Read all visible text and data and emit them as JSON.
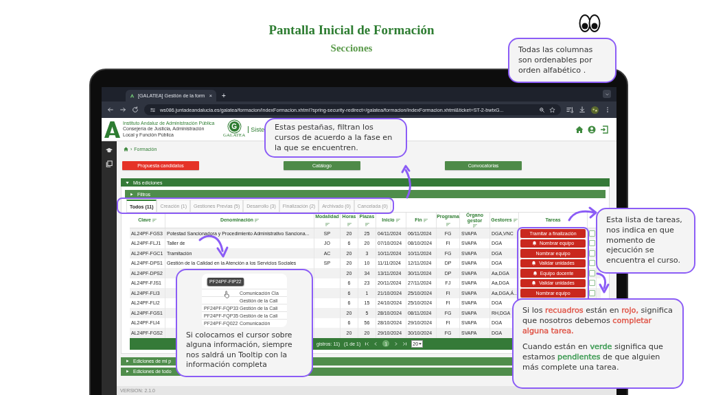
{
  "slide": {
    "title": "Pantalla Inicial de Formación",
    "subtitle": "Secciones"
  },
  "browser": {
    "tab_title": "[GALATEA] Gestión de la form",
    "tab_close": "×",
    "new_tab": "+",
    "url": "ws086.juntadeandalucia.es/galatea/formacion/indexFormacion.xhtml?spring-security-redirect=/galatea/formacion/indexFormacion.xhtml&ticket=ST-2-bwtxG..."
  },
  "header": {
    "org_lines": [
      "Instituto Andaluz de Administración Pública",
      "Consejería de Justicia, Administración",
      "Local y Función Pública"
    ],
    "logo_letter": "G",
    "logo_caption": "GALATEA",
    "system_name": "Siste"
  },
  "breadcrumb": {
    "separator": "›",
    "label": "Formación"
  },
  "actions": [
    {
      "label": "Propuesta candidatos",
      "kind": "alert"
    },
    {
      "label": "Catálogo",
      "kind": "normal"
    },
    {
      "label": "Convocatorias",
      "kind": "normal"
    }
  ],
  "panel": {
    "title": "Mis ediciones",
    "expanded": true
  },
  "filters": {
    "title": "Filtros",
    "expanded": false
  },
  "tabs": [
    {
      "label": "Todos (11)",
      "selected": true
    },
    {
      "label": "Creación (1)",
      "selected": false
    },
    {
      "label": "Gestiones Previas (5)",
      "selected": false
    },
    {
      "label": "Desarrollo (3)",
      "selected": false
    },
    {
      "label": "Finalización (2)",
      "selected": false
    },
    {
      "label": "Archivado (0)",
      "selected": false
    },
    {
      "label": "Cancelada (0)",
      "selected": false
    }
  ],
  "table": {
    "columns": [
      {
        "label": "Clave",
        "sortable": true
      },
      {
        "label": "Denominación",
        "sortable": true
      },
      {
        "label": "Modalidad",
        "sortable": true
      },
      {
        "label": "Horas",
        "sortable": true
      },
      {
        "label": "Plazas",
        "sortable": true
      },
      {
        "label": "Inicio",
        "sortable": true
      },
      {
        "label": "Fin",
        "sortable": true
      },
      {
        "label": "Programa",
        "sortable": true
      },
      {
        "label": "Órgano gestor",
        "sortable": true
      },
      {
        "label": "Gestores",
        "sortable": true
      },
      {
        "label": "Tareas",
        "sortable": false
      }
    ],
    "rows": [
      {
        "clave": "AL24PF-FGS3",
        "denominacion": "Potestad Sancionadora y Procedimiento Administrativo Sanciona...",
        "modalidad": "SP",
        "horas": "20",
        "plazas": "25",
        "inicio": "04/11/2024",
        "fin": "06/11/2024",
        "programa": "FG",
        "organo": "SVAPA",
        "gestores": "DGA,VNC",
        "task": {
          "label": "Tramitar a finalización",
          "bell": false,
          "kind": "required"
        },
        "checked": false
      },
      {
        "clave": "AL24PF-FLJ1",
        "denominacion": "Taller de",
        "modalidad": "JO",
        "horas": "6",
        "plazas": "20",
        "inicio": "07/10/2024",
        "fin": "08/10/2024",
        "programa": "FI",
        "organo": "SVAPA",
        "gestores": "DGA",
        "task": {
          "label": "Nombrar equipo",
          "bell": true,
          "kind": "required"
        },
        "checked": false
      },
      {
        "clave": "AL24PF-FGC1",
        "denominacion": "Tramitación",
        "modalidad": "AC",
        "horas": "20",
        "plazas": "3",
        "inicio": "10/11/2024",
        "fin": "10/11/2024",
        "programa": "FG",
        "organo": "SVAPA",
        "gestores": "DGA",
        "task": {
          "label": "Nombrar equipo",
          "bell": false,
          "kind": "required"
        },
        "checked": false
      },
      {
        "clave": "AL24PF-DPS1",
        "denominacion": "Gestión de la Calidad en la Atención a los Servicios Sociales",
        "modalidad": "SP",
        "horas": "20",
        "plazas": "10",
        "inicio": "11/11/2024",
        "fin": "12/11/2024",
        "programa": "DP",
        "organo": "SVAPA",
        "gestores": "DGA",
        "task": {
          "label": "Validar unidades",
          "bell": true,
          "kind": "required"
        },
        "checked": false
      },
      {
        "clave": "AL24PF-DPS2",
        "horas": "20",
        "plazas": "34",
        "inicio": "13/11/2024",
        "fin": "30/11/2024",
        "programa": "DP",
        "organo": "SVAPA",
        "gestores": "Aa,DGA",
        "task": {
          "label": "Equipo docente",
          "bell": true,
          "kind": "required"
        },
        "checked": false
      },
      {
        "clave": "AL24PF-FJS1",
        "horas": "6",
        "plazas": "23",
        "inicio": "20/11/2024",
        "fin": "27/11/2024",
        "programa": "FJ",
        "organo": "SVAPA",
        "gestores": "Aa,DGA",
        "task": {
          "label": "Validar unidades",
          "bell": true,
          "kind": "required"
        },
        "checked": false
      },
      {
        "clave": "AL24PF-FLI3",
        "horas": "6",
        "plazas": "1",
        "inicio": "21/10/2024",
        "fin": "25/10/2024",
        "programa": "FI",
        "organo": "SVAPA",
        "gestores": "Aa,DGA,Á...",
        "task": {
          "label": "Nombrar equipo",
          "bell": false,
          "kind": "required"
        },
        "checked": false
      },
      {
        "clave": "AL24PF-FLI2",
        "horas": "6",
        "plazas": "15",
        "inicio": "24/10/2024",
        "fin": "25/10/2024",
        "programa": "FI",
        "organo": "SVAPA",
        "gestores": "DGA"
      },
      {
        "clave": "AL24PF-FGS1",
        "horas": "20",
        "plazas": "5",
        "inicio": "28/10/2024",
        "fin": "08/11/2024",
        "programa": "FG",
        "organo": "SVAPA",
        "gestores": "RH,DGA"
      },
      {
        "clave": "AL24PF-FLI4",
        "horas": "6",
        "plazas": "56",
        "inicio": "28/10/2024",
        "fin": "29/10/2024",
        "programa": "FI",
        "organo": "SVAPA",
        "gestores": "DGA"
      },
      {
        "clave": "AL24PF-FGS2",
        "horas": "20",
        "plazas": "20",
        "inicio": "29/10/2024",
        "fin": "30/10/2024",
        "programa": "FG",
        "organo": "SVAPA",
        "gestores": "DGA"
      }
    ],
    "footer": {
      "records": "gistros: 11)",
      "page_info": "(1 de 1)",
      "pages": [
        {
          "label": "1",
          "selected": true
        }
      ],
      "page_size": "20"
    }
  },
  "other_panels": [
    {
      "title": "Ediciones de mi p",
      "expanded": false
    },
    {
      "title": "Ediciones de todo",
      "expanded": false
    }
  ],
  "version": "VERSION: 2.1.0",
  "callouts": [
    {
      "kind": "text",
      "paragraphs": [
        [
          {
            "text": "Todas las columnas son ordenables por orden alfabético ."
          }
        ]
      ]
    },
    {
      "kind": "text",
      "paragraphs": [
        [
          {
            "text": "Estas pestañas, filtran los cursos de acuerdo a la fase en la que se encuentren."
          }
        ]
      ]
    },
    {
      "kind": "text",
      "paragraphs": [
        [
          {
            "text": "Esta lista de tareas, nos indica en que momento de ejecución se encuentra el curso."
          }
        ]
      ]
    },
    {
      "kind": "preview",
      "preview": {
        "tooltip": "PF24PF-FIP22",
        "rows": [
          {
            "name": "Comunicación Cla"
          },
          {
            "name": "Gestión de la Cali"
          },
          {
            "code": "PF24PF-FQP33",
            "name": "Gestión de la Cali"
          },
          {
            "code": "PF24PF-FQP35",
            "name": "Gestión de la Cali"
          },
          {
            "code": "PF24PF-FQ022",
            "name": "Comunicación"
          }
        ]
      },
      "paragraphs": [
        [
          {
            "text": "Si colocamos el cursor sobre alguna información, siempre nos saldrá un Tooltip con la información completa"
          }
        ]
      ]
    },
    {
      "kind": "text",
      "paragraphs": [
        [
          {
            "text": "Si los "
          },
          {
            "text": "recuadros",
            "color": "#e0574a"
          },
          {
            "text": " están en "
          },
          {
            "text": "rojo,",
            "color": "#e0574a"
          },
          {
            "text": " significa que nosotros debemos "
          },
          {
            "text": "completar alguna tarea.",
            "color": "#e0574a"
          }
        ],
        [
          {
            "text": "Cuando están en "
          },
          {
            "text": "verde",
            "color": "#3c9a52"
          },
          {
            "text": " significa que estamos "
          },
          {
            "text": "pendientes",
            "color": "#3c9a52"
          },
          {
            "text": " de que alguien más complete una tarea."
          }
        ]
      ]
    }
  ]
}
